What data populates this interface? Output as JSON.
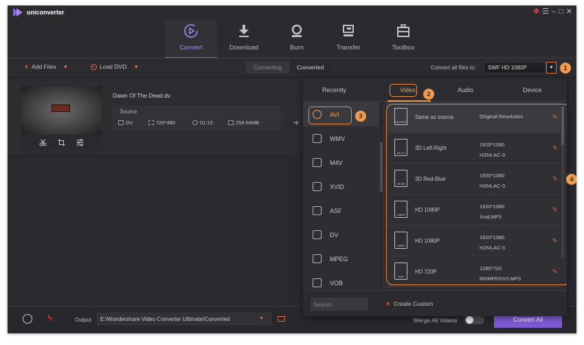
{
  "app": {
    "name": "uniconverter"
  },
  "window_controls": [
    "gift-icon",
    "menu-icon",
    "minimize-icon",
    "maximize-icon",
    "close-icon"
  ],
  "nav": {
    "tabs": [
      {
        "label": "Convert",
        "icon": "convert-icon",
        "active": true
      },
      {
        "label": "Download",
        "icon": "download-icon",
        "active": false
      },
      {
        "label": "Burn",
        "icon": "burn-icon",
        "active": false
      },
      {
        "label": "Transfer",
        "icon": "transfer-icon",
        "active": false
      },
      {
        "label": "Toolbox",
        "icon": "toolbox-icon",
        "active": false
      }
    ]
  },
  "toolbar": {
    "add_files": "Add Files",
    "load_dvd": "Load DVD",
    "segment": [
      "Converting",
      "Converted"
    ],
    "convert_all_to_label": "Convert all files to:",
    "format_value": "SWF HD 1080P"
  },
  "file": {
    "name": "Dawn Of The Dead.dv",
    "source_label": "Source",
    "format": "DV",
    "resolution": "720*480",
    "duration": "01:15",
    "size": "258.64MB"
  },
  "panel": {
    "tabs": [
      "Recently",
      "Video",
      "Audio",
      "Device"
    ],
    "active_tab": "Video",
    "formats": [
      "AVI",
      "WMV",
      "M4V",
      "XVID",
      "ASF",
      "DV",
      "MPEG",
      "VOB"
    ],
    "active_format": "AVI",
    "presets": [
      {
        "name": "Same as source",
        "res": "Original Resolution",
        "codec": "",
        "tag": "SOURCE"
      },
      {
        "name": "3D Left-Right",
        "res": "1920*1080",
        "codec": "H264,AC-3",
        "tag": "3D LR"
      },
      {
        "name": "3D Red-Blue",
        "res": "1920*1080",
        "codec": "H264,AC-3",
        "tag": "3D RB"
      },
      {
        "name": "HD 1080P",
        "res": "1920*1080",
        "codec": "Xvid,MP3",
        "tag": "1080P"
      },
      {
        "name": "HD 1080P",
        "res": "1920*1080",
        "codec": "H264,AC-3",
        "tag": "1080P"
      },
      {
        "name": "HD 720P",
        "res": "1280*720",
        "codec": "MSMPEGV3,MP3",
        "tag": "720P"
      }
    ],
    "search_placeholder": "Search",
    "create_custom": "Create Custom"
  },
  "callouts": [
    "1",
    "2",
    "3",
    "4"
  ],
  "bottom": {
    "output_label": "Output",
    "output_path": "E:\\Wondershare Video Converter Ultimate\\Converted",
    "merge_label": "Merge All Videos",
    "merge_on": false,
    "convert_all": "Convert All"
  },
  "colors": {
    "accent": "#7d5cd4",
    "highlight": "#f08c40",
    "background": "#2a2a2e"
  }
}
